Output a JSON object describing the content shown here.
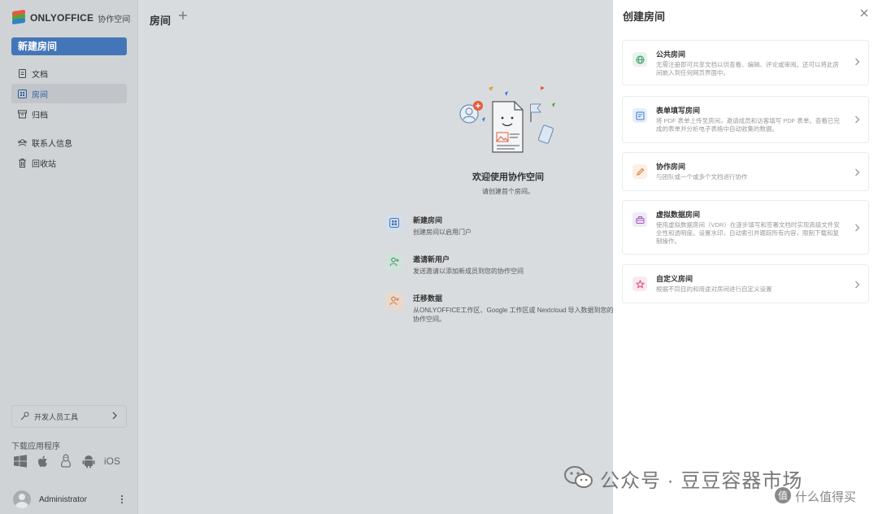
{
  "sidebar": {
    "logo_text": "ONLYOFFICE",
    "logo_sub": "协作空间",
    "new_room": "新建房间",
    "items": [
      {
        "label": "文档"
      },
      {
        "label": "房间"
      },
      {
        "label": "归档"
      },
      {
        "label": "联系人信息"
      },
      {
        "label": "回收站"
      }
    ],
    "dev_tools": "开发人员工具",
    "download_label": "下载应用程序",
    "ios": "iOS",
    "user_name": "Administrator"
  },
  "main": {
    "title": "房间",
    "welcome_title": "欢迎使用协作空间",
    "welcome_sub": "请创建首个房间。",
    "actions": [
      {
        "title": "新建房间",
        "desc": "创建房间以启用门户"
      },
      {
        "title": "邀请新用户",
        "desc": "发送邀请以添加新成员到您的协作空间"
      },
      {
        "title": "迁移数据",
        "desc": "从ONLYOFFICE工作区、Google 工作区或 Nextcloud 导入数据到您的协作空间。"
      }
    ]
  },
  "panel": {
    "title": "创建房间",
    "rooms": [
      {
        "title": "公共房间",
        "desc": "无需注册即可共享文档以供查看、编辑、评论或审阅。还可以将此房间嵌入到任何网页界面中。"
      },
      {
        "title": "表单填写房间",
        "desc": "将 PDF 表单上传至房间，邀请成员和访客填写 PDF 表单。查看已完成的表单并分析电子表格中自动收集的数据。"
      },
      {
        "title": "协作房间",
        "desc": "与团队或一个或多个文档进行协作"
      },
      {
        "title": "虚拟数据房间",
        "desc": "使用虚拟数据房间（VDR）在逐步填写和签署文档时实现高级文件安全性和透明度。设置水印，自动索引并跟踪所有内容，限制下载和复制操作。"
      },
      {
        "title": "自定义房间",
        "desc": "根据不同目的和用途对房间进行自定义设置"
      }
    ]
  },
  "watermark": {
    "text": "公众号 · 豆豆容器市场",
    "text2": "什么值得买"
  },
  "colors": {
    "accent": "#4376b8",
    "panel_bg": "#ffffff",
    "overlay_bg": "#d9dcdf"
  }
}
